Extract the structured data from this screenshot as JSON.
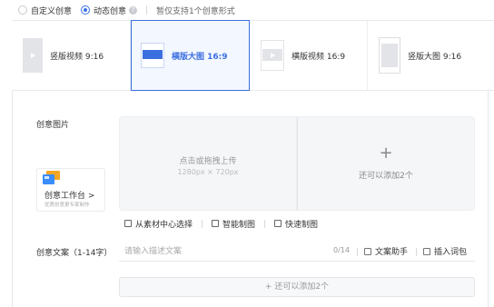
{
  "creative_mode": {
    "options": [
      {
        "label": "自定义创意",
        "checked": false
      },
      {
        "label": "动态创意",
        "checked": true
      }
    ],
    "hint": "暂仅支持1个创意形式"
  },
  "formats": [
    {
      "label": "竖版视频 9:16",
      "active": false
    },
    {
      "label": "横版大图 16:9",
      "active": true
    },
    {
      "label": "横版视频 16:9",
      "active": false
    },
    {
      "label": "竖版大图 9:16",
      "active": false
    }
  ],
  "image_section": {
    "label": "创意图片",
    "workbench_title": "创意工作台 >",
    "workbench_subtitle": "优质创意更专家制作",
    "upload_text": "点击或拖拽上传",
    "upload_size": "1280px × 720px",
    "add_more_symbol": "+",
    "add_more_text": "还可以添加2个",
    "tools": [
      "从素材中心选择",
      "智能制图",
      "快速制图"
    ]
  },
  "copy_section": {
    "label": "创意文案（1-14字）",
    "placeholder": "请输入描述文案",
    "count": "0/14",
    "assistant_label": "文案助手",
    "insert_label": "插入词包",
    "add_label": "+ 还可以添加2个"
  },
  "colors": {
    "accent": "#3b6fe0",
    "card_bg": "#f5f6f8",
    "thumb_bg": "#e3e4e7"
  }
}
